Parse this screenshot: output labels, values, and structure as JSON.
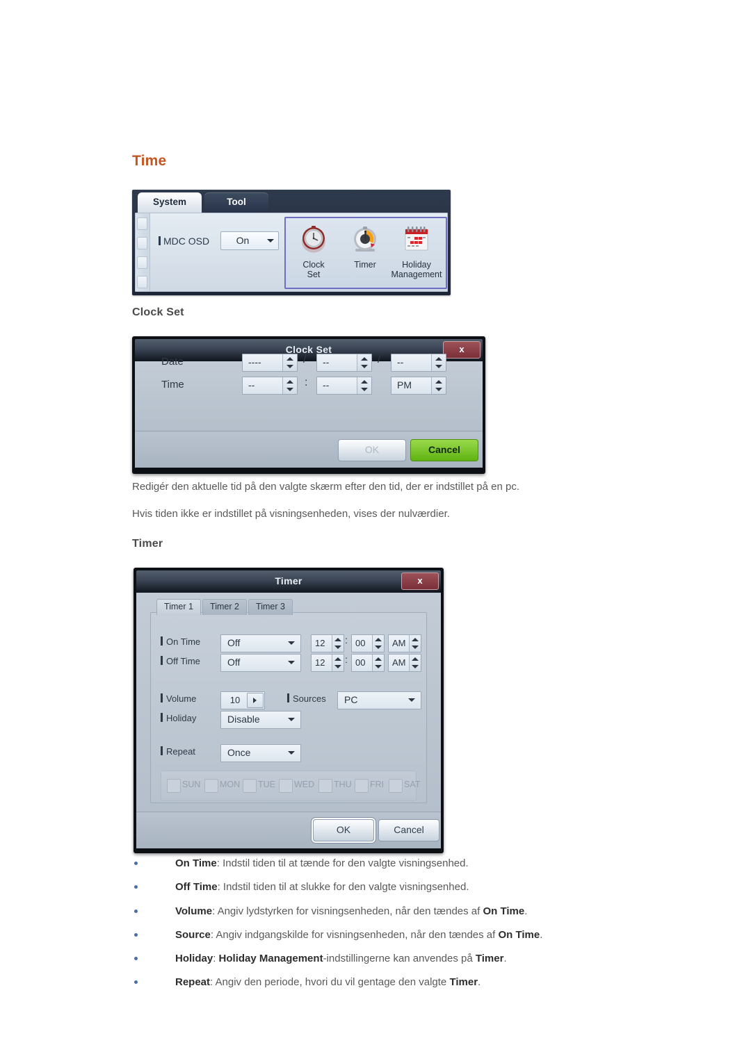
{
  "headings": {
    "time": "Time",
    "clock_set": "Clock Set",
    "timer": "Timer"
  },
  "toolbar": {
    "tabs": [
      {
        "label": "System",
        "active": true
      },
      {
        "label": "Tool",
        "active": false
      }
    ],
    "osd_label": "MDC OSD",
    "osd_value": "On",
    "icons": [
      {
        "name": "clock-set",
        "line1": "Clock",
        "line2": "Set"
      },
      {
        "name": "timer",
        "line1": "Timer",
        "line2": ""
      },
      {
        "name": "holiday-management",
        "line1": "Holiday",
        "line2": "Management"
      }
    ],
    "selection_color": "#6f6fc2"
  },
  "clock_set_dialog": {
    "title": "Clock Set",
    "close_label": "x",
    "rows": [
      {
        "label": "Date",
        "fields": [
          "----",
          "--",
          "--"
        ],
        "separators": [
          "/",
          "/"
        ]
      },
      {
        "label": "Time",
        "fields": [
          "--",
          "--",
          "PM"
        ],
        "separators": [
          ":",
          ""
        ]
      }
    ],
    "buttons": [
      {
        "label": "OK",
        "style": "grey-disabled"
      },
      {
        "label": "Cancel",
        "style": "green"
      }
    ]
  },
  "timer_dialog": {
    "title": "Timer",
    "close_label": "x",
    "tabs": [
      {
        "label": "Timer 1",
        "active": true
      },
      {
        "label": "Timer 2",
        "active": false
      },
      {
        "label": "Timer 3",
        "active": false
      }
    ],
    "on_time": {
      "label": "On Time",
      "mode": "Off",
      "hour": "12",
      "minute": "00",
      "meridiem": "AM",
      "separator": ":"
    },
    "off_time": {
      "label": "Off Time",
      "mode": "Off",
      "hour": "12",
      "minute": "00",
      "meridiem": "AM",
      "separator": ":"
    },
    "volume": {
      "label": "Volume",
      "value": "10"
    },
    "sources": {
      "label": "Sources",
      "value": "PC"
    },
    "holiday": {
      "label": "Holiday",
      "value": "Disable"
    },
    "repeat": {
      "label": "Repeat",
      "value": "Once"
    },
    "days": [
      "SUN",
      "MON",
      "TUE",
      "WED",
      "THU",
      "FRI",
      "SAT"
    ],
    "buttons": [
      {
        "label": "OK",
        "style": "grey-focus"
      },
      {
        "label": "Cancel",
        "style": "grey"
      }
    ]
  },
  "paragraphs": [
    "Redigér den aktuelle tid på den valgte skærm efter den tid, der er indstillet på en pc.",
    "Hvis tiden ikke er indstillet på visningsenheden, vises der nulværdier."
  ],
  "bullets": [
    {
      "term": "On Time",
      "text_before": ": Indstil tiden til at tænde for den valgte visningsenhed.",
      "emph": "",
      "text_after": ""
    },
    {
      "term": "Off Time",
      "text_before": ": Indstil tiden til at slukke for den valgte visningsenhed.",
      "emph": "",
      "text_after": ""
    },
    {
      "term": "Volume",
      "text_before": ": Angiv lydstyrken for visningsenheden, når den tændes af ",
      "emph": "On Time",
      "text_after": "."
    },
    {
      "term": "Source",
      "text_before": ": Angiv indgangskilde for visningsenheden, når den tændes af ",
      "emph": "On Time",
      "text_after": "."
    },
    {
      "term": "Holiday",
      "text_before": ": ",
      "emph": "Holiday Management",
      "text_after": "-indstillingerne kan anvendes på ",
      "emph2": "Timer",
      "text_end": "."
    },
    {
      "term": "Repeat",
      "text_before": ": Angiv den periode, hvori du vil gentage den valgte ",
      "emph": "Timer",
      "text_after": "."
    }
  ]
}
